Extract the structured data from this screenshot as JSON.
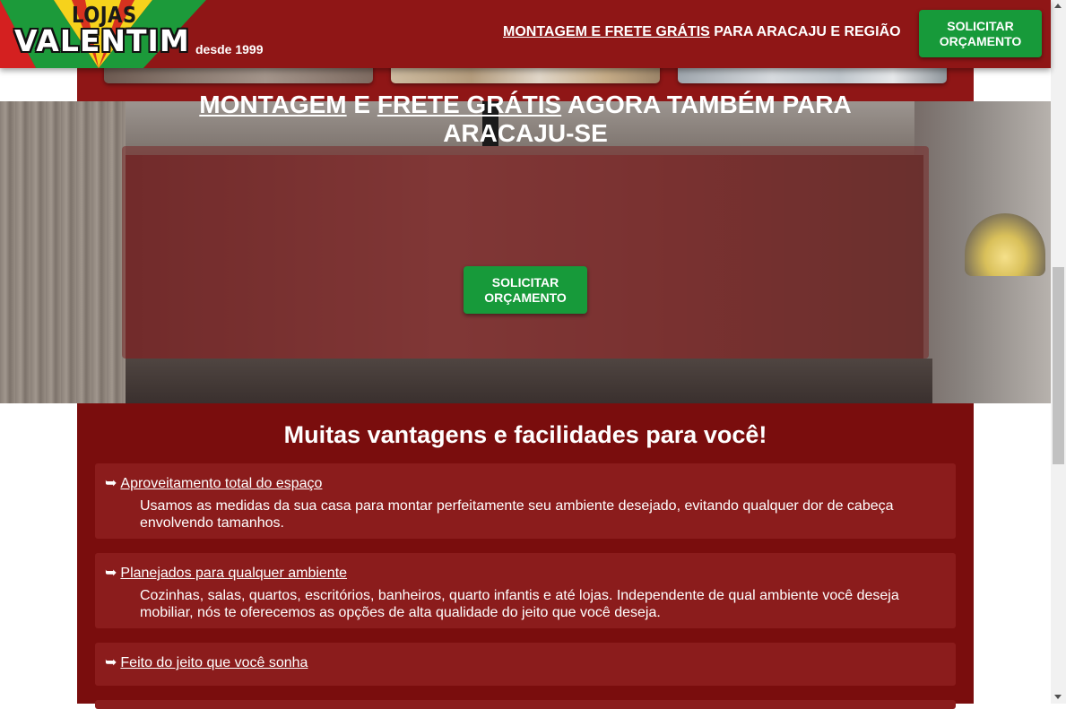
{
  "header": {
    "logo": {
      "top_text": "LOJAS",
      "main_text": "VALENTIM",
      "since": "desde 1999"
    },
    "promo": {
      "highlight": "MONTAGEM E FRETE GRÁTIS",
      "rest": " PARA ARACAJU E REGIÃO"
    },
    "cta": {
      "line1": "SOLICITAR",
      "line2": "ORÇAMENTO"
    }
  },
  "hero": {
    "title_part1": "MONTAGEM",
    "title_part2": " E ",
    "title_part3": "FRETE GRÁTIS",
    "title_part4": " AGORA TAMBÉM PARA",
    "title_line2": "ARACAJU-SE",
    "cta": {
      "line1": "SOLICITAR",
      "line2": "ORÇAMENTO"
    }
  },
  "benefits": {
    "title": "Muitas vantagens e facilidades para você!",
    "items": [
      {
        "arrow": "➥",
        "title": "Aproveitamento total do espaço",
        "text": "Usamos as medidas da sua casa para montar perfeitamente seu ambiente desejado, evitando qualquer dor de cabeça envolvendo tamanhos."
      },
      {
        "arrow": "➥",
        "title": "Planejados para qualquer ambiente",
        "text": "Cozinhas, salas, quartos, escritórios, banheiros, quarto infantis e até lojas. Independente de qual ambiente você deseja mobiliar, nós te oferecemos as opções de alta qualidade do jeito que você deseja."
      },
      {
        "arrow": "➥",
        "title": "Feito do jeito que você sonha",
        "text": ""
      }
    ]
  },
  "colors": {
    "header_bg": "#8f1616",
    "section_bg": "#7a0d0d",
    "card_bg": "#8b1c1c",
    "cta_green": "#179a3a",
    "logo_yellow": "#f6d21c",
    "logo_green": "#1c9a3a",
    "logo_red": "#d42020"
  }
}
